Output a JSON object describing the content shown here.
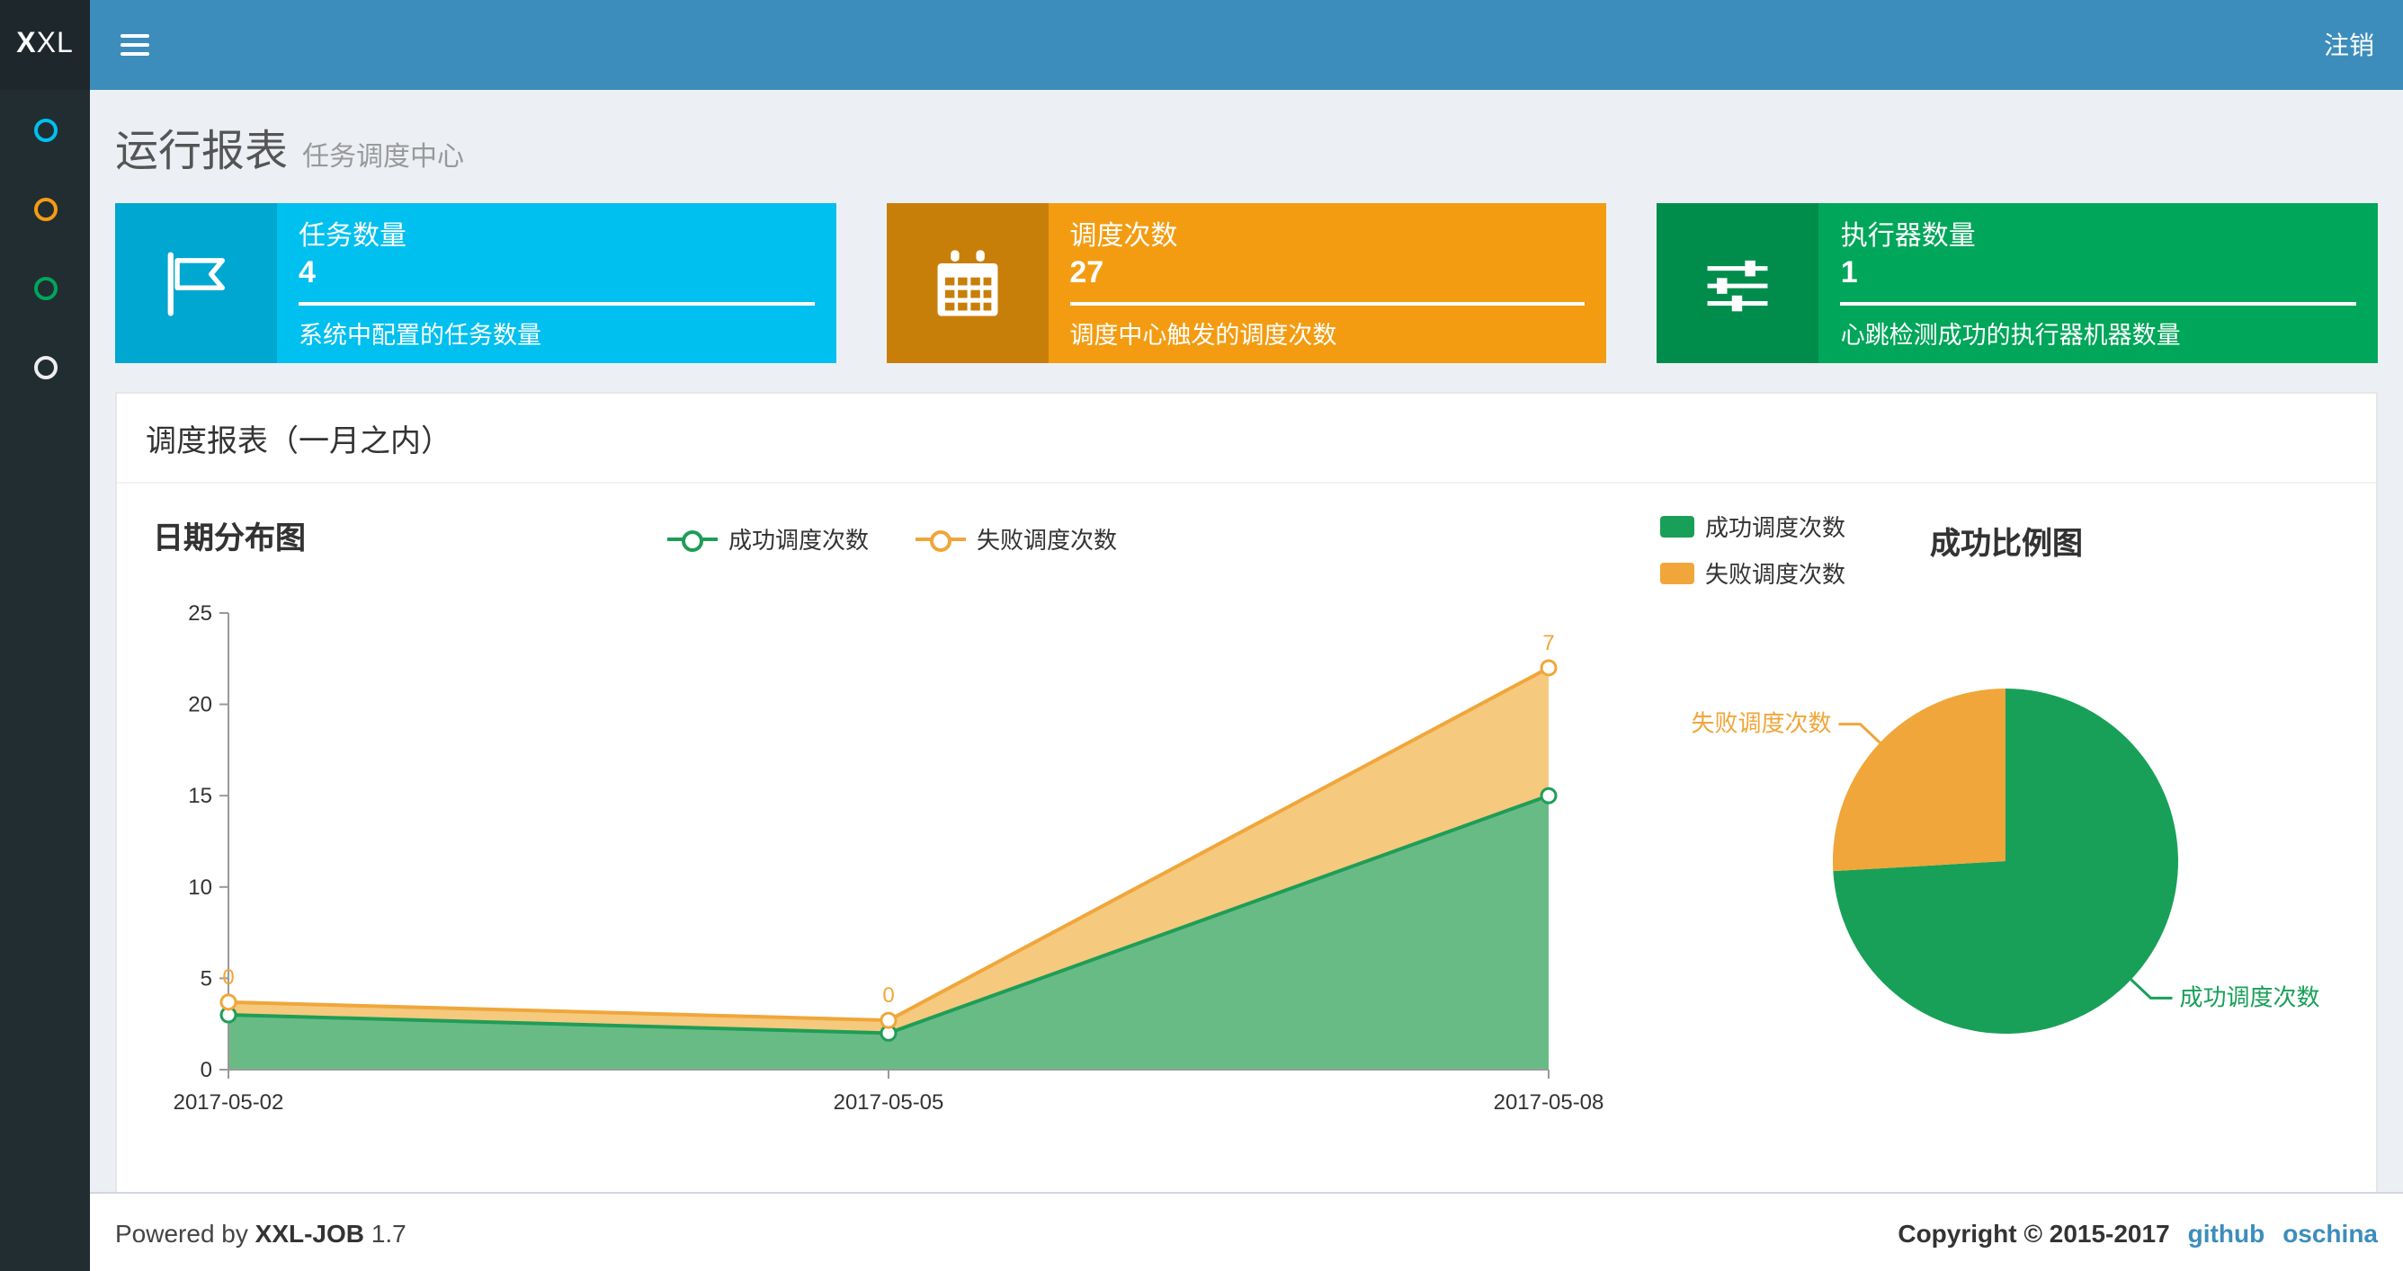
{
  "header": {
    "logo_bold": "X",
    "logo_rest": "XL",
    "logout_label": "注销"
  },
  "sidebar": {
    "items": [
      {
        "icon": "circle-outline-icon",
        "color": "#00c0ef"
      },
      {
        "icon": "circle-outline-icon",
        "color": "#f39c12"
      },
      {
        "icon": "circle-outline-icon",
        "color": "#00a65a"
      },
      {
        "icon": "circle-outline-icon",
        "color": "#eeeeee"
      }
    ]
  },
  "page": {
    "title": "运行报表",
    "subtitle": "任务调度中心"
  },
  "info_boxes": [
    {
      "icon": "flag-icon",
      "title": "任务数量",
      "value": "4",
      "desc": "系统中配置的任务数量",
      "bg": "#00c0ef",
      "icon_bg": "#00a7d0"
    },
    {
      "icon": "calendar-icon",
      "title": "调度次数",
      "value": "27",
      "desc": "调度中心触发的调度次数",
      "bg": "#f39c12",
      "icon_bg": "#c87f0a"
    },
    {
      "icon": "sliders-icon",
      "title": "执行器数量",
      "value": "1",
      "desc": "心跳检测成功的执行器机器数量",
      "bg": "#00a65a",
      "icon_bg": "#008d4c"
    }
  ],
  "panel": {
    "title": "调度报表（一月之内）"
  },
  "chart_data": [
    {
      "type": "area",
      "title": "日期分布图",
      "x": [
        "2017-05-02",
        "2017-05-05",
        "2017-05-08"
      ],
      "series": [
        {
          "name": "成功调度次数",
          "values": [
            3,
            2,
            15
          ],
          "stacked": true,
          "color": "#1f9d57",
          "fill": "#69bb86"
        },
        {
          "name": "失败调度次数",
          "values": [
            0,
            0,
            7
          ],
          "stacked": true,
          "color": "#f0a63a",
          "fill": "#f5c97e",
          "point_labels": [
            "0",
            "0",
            "7"
          ]
        }
      ],
      "ylim": [
        0,
        25
      ],
      "yticks": [
        0,
        5,
        10,
        15,
        20,
        25
      ],
      "grid": false,
      "legend_position": "top"
    },
    {
      "type": "pie",
      "title": "成功比例图",
      "slices": [
        {
          "label": "成功调度次数",
          "value": 20,
          "color": "#18a058"
        },
        {
          "label": "失败调度次数",
          "value": 7,
          "color": "#f0a63a"
        }
      ],
      "start_angle_deg": 90,
      "direction": "clockwise",
      "legend_position": "top-left"
    }
  ],
  "footer": {
    "powered_by": "Powered by",
    "brand": "XXL-JOB",
    "version": "1.7",
    "copyright": "Copyright © 2015-2017",
    "links": [
      {
        "label": "github"
      },
      {
        "label": "oschina"
      }
    ]
  }
}
